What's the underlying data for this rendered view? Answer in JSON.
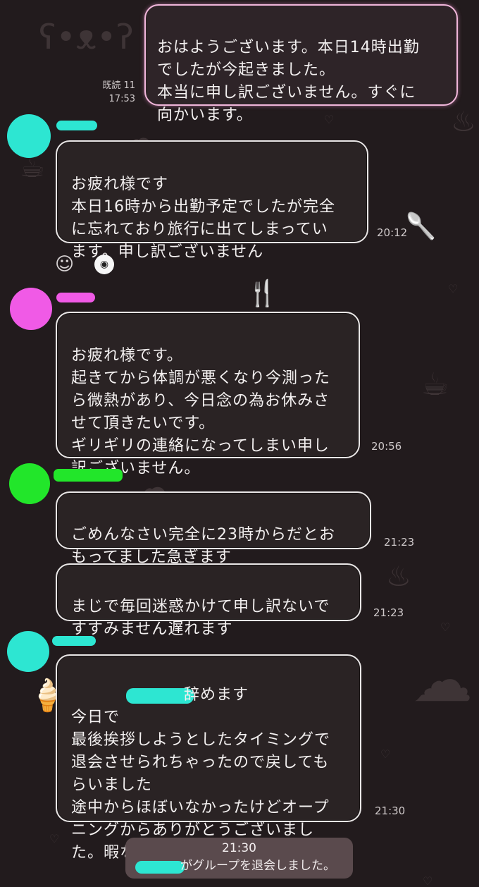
{
  "messages": {
    "mine": {
      "text": "おはようございます。本日14時出勤\nでしたが今起きました。\n本当に申し訳ございません。すぐに\n向かいます。",
      "read_label": "既読 11",
      "time": "17:53"
    },
    "m1": {
      "text": "お疲れ様です\n本日16時から出勤予定でしたが完全\nに忘れており旅行に出てしまってい\nます。申し訳ございません",
      "time": "20:12"
    },
    "m2": {
      "text": "お疲れ様です。\n起きてから体調が悪くなり今測った\nら微熱があり、今日念の為お休みさ\nせて頂きたいです。\nギリギリの連絡になってしまい申し\n訳ございません。",
      "time": "20:56"
    },
    "m3": {
      "text": "ごめんなさい完全に23時からだとお\nもってました急ぎます",
      "time": "21:23"
    },
    "m4": {
      "text": "まじで毎回迷惑かけて申し訳ないで\nすすみません遅れます",
      "time": "21:23"
    },
    "m5": {
      "text_prefix": "今日で",
      "text_suffix": "辞めます",
      "text_rest": "最後挨拶しようとしたタイミングで\n退会させられちゃったので戻しても\nらいました\n途中からほぼいなかったけどオープ\nニングからありがとうございまし\nた。暇な時遊び行きます",
      "time": "21:30"
    }
  },
  "system": {
    "time": "21:30",
    "text": "がグループを退会しました。"
  },
  "colors": {
    "background": "#221b1d",
    "bubble_border": "#e9e6e6",
    "mine_border": "#f0b6da",
    "avatar_cyan": "#2de6d2",
    "avatar_magenta": "#f05ae6",
    "avatar_green": "#22e62a",
    "system_bg": "#5a4a4d"
  },
  "icons": {
    "smile": "smile-icon",
    "sticker": "surprised-face-sticker"
  }
}
